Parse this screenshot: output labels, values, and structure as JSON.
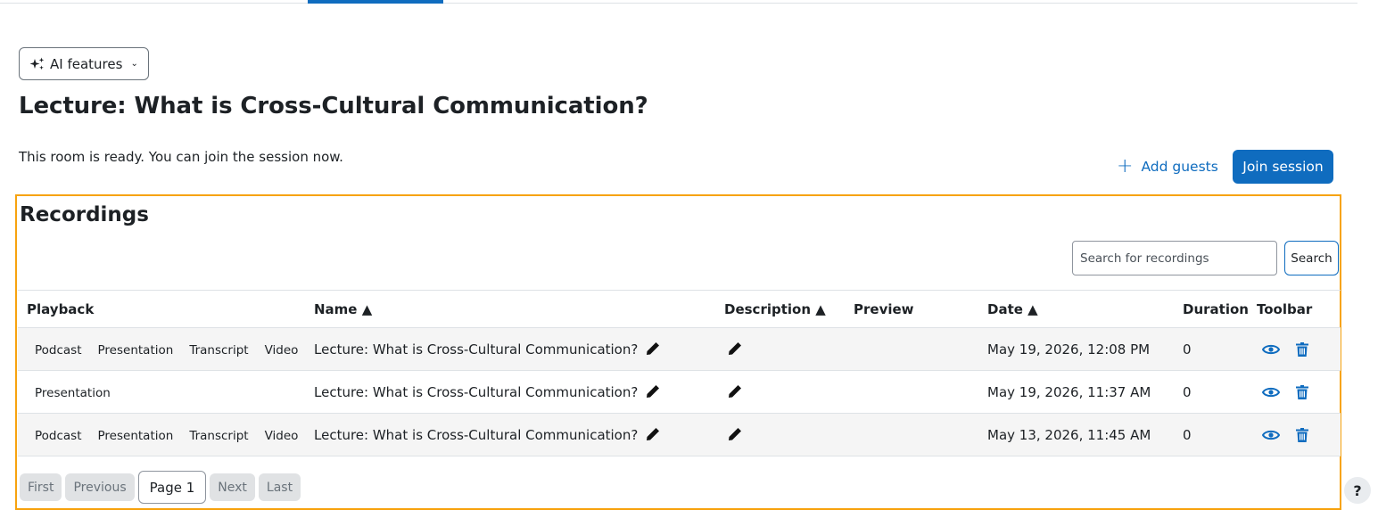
{
  "ai_features": {
    "label": "AI features"
  },
  "page": {
    "title": "Lecture: What is Cross-Cultural Communication?",
    "status": "This room is ready. You can join the session now."
  },
  "actions": {
    "add_guests": "Add guests",
    "join_session": "Join session"
  },
  "recordings": {
    "heading": "Recordings",
    "search_placeholder": "Search for recordings",
    "search_button": "Search",
    "columns": {
      "playback": "Playback",
      "name": "Name ▲",
      "description": "Description ▲",
      "preview": "Preview",
      "date": "Date ▲",
      "duration": "Duration",
      "toolbar": "Toolbar"
    },
    "rows": [
      {
        "playback": [
          "Podcast",
          "Presentation",
          "Transcript",
          "Video"
        ],
        "name": "Lecture: What is Cross-Cultural Communication?",
        "date": "May 19, 2026, 12:08 PM",
        "duration": "0"
      },
      {
        "playback": [
          "Presentation"
        ],
        "name": "Lecture: What is Cross-Cultural Communication?",
        "date": "May 19, 2026, 11:37 AM",
        "duration": "0"
      },
      {
        "playback": [
          "Podcast",
          "Presentation",
          "Transcript",
          "Video"
        ],
        "name": "Lecture: What is Cross-Cultural Communication?",
        "date": "May 13, 2026, 11:45 AM",
        "duration": "0"
      }
    ],
    "pagination": {
      "first": "First",
      "previous": "Previous",
      "current": "Page 1",
      "next": "Next",
      "last": "Last"
    }
  },
  "help": {
    "label": "?"
  },
  "colors": {
    "primary": "#0f6cbf",
    "highlight": "#f7a30f",
    "row_stripe": "#f5f5f5"
  },
  "icons": {
    "ai": "sparkle-icon",
    "dropdown": "chevron-down-icon",
    "add": "plus-icon",
    "edit": "pencil-icon",
    "view": "eye-icon",
    "delete": "trash-icon"
  }
}
